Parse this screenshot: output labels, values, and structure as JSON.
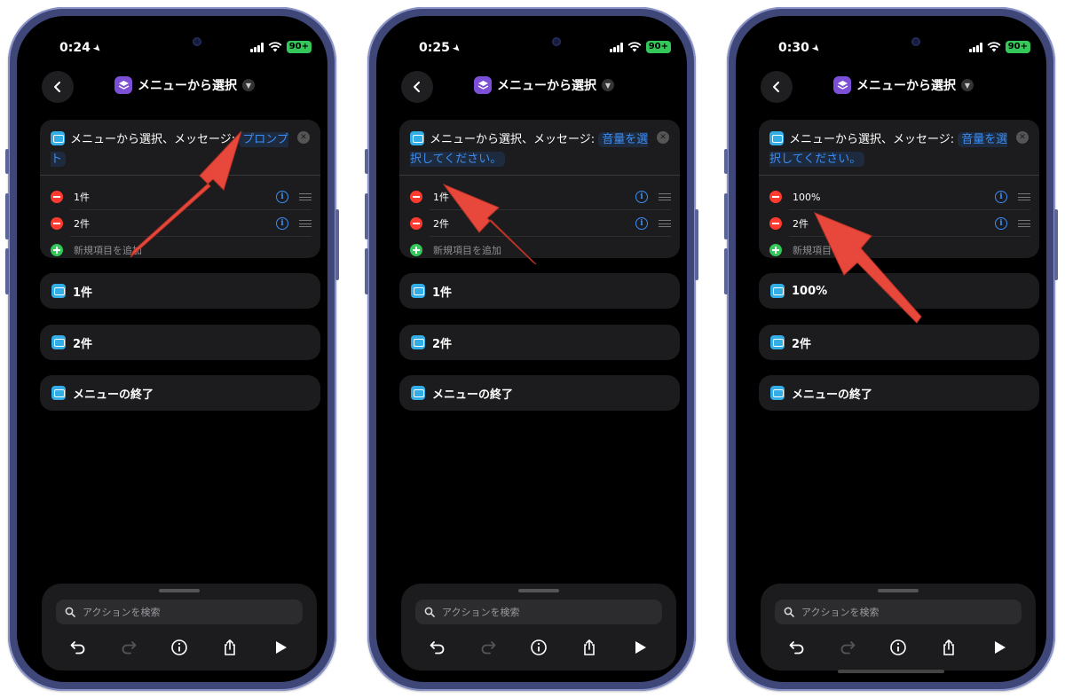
{
  "screens": [
    {
      "status_time": "0:24",
      "battery": "90+",
      "nav_title": "メニューから選択",
      "header_text": "メニューから選択、メッセージ: ",
      "param_text": "プロンプト",
      "items": [
        "1件",
        "2件"
      ],
      "add_label": "新規項目を追加",
      "blocks": [
        "1件",
        "2件",
        "メニューの終了"
      ],
      "search_placeholder": "アクションを検索"
    },
    {
      "status_time": "0:25",
      "battery": "90+",
      "nav_title": "メニューから選択",
      "header_text": "メニューから選択、メッセージ: ",
      "param_text": "音量を選択してください。",
      "items": [
        "1件",
        "2件"
      ],
      "add_label": "新規項目を追加",
      "blocks": [
        "1件",
        "2件",
        "メニューの終了"
      ],
      "search_placeholder": "アクションを検索"
    },
    {
      "status_time": "0:30",
      "battery": "90+",
      "nav_title": "メニューから選択",
      "header_text": "メニューから選択、メッセージ: ",
      "param_text": "音量を選択してください。",
      "items": [
        "100%",
        "2件"
      ],
      "add_label": "新規項目を追加",
      "blocks": [
        "100%",
        "2件",
        "メニューの終了"
      ],
      "search_placeholder": "アクションを検索"
    }
  ],
  "colors": {
    "accent": "#3a8ef6",
    "annotation_arrow": "#e8473c",
    "phone_frame": "#3e4778",
    "card_bg": "#1c1c1e",
    "shortcut_icon": "#7b4fd6"
  }
}
